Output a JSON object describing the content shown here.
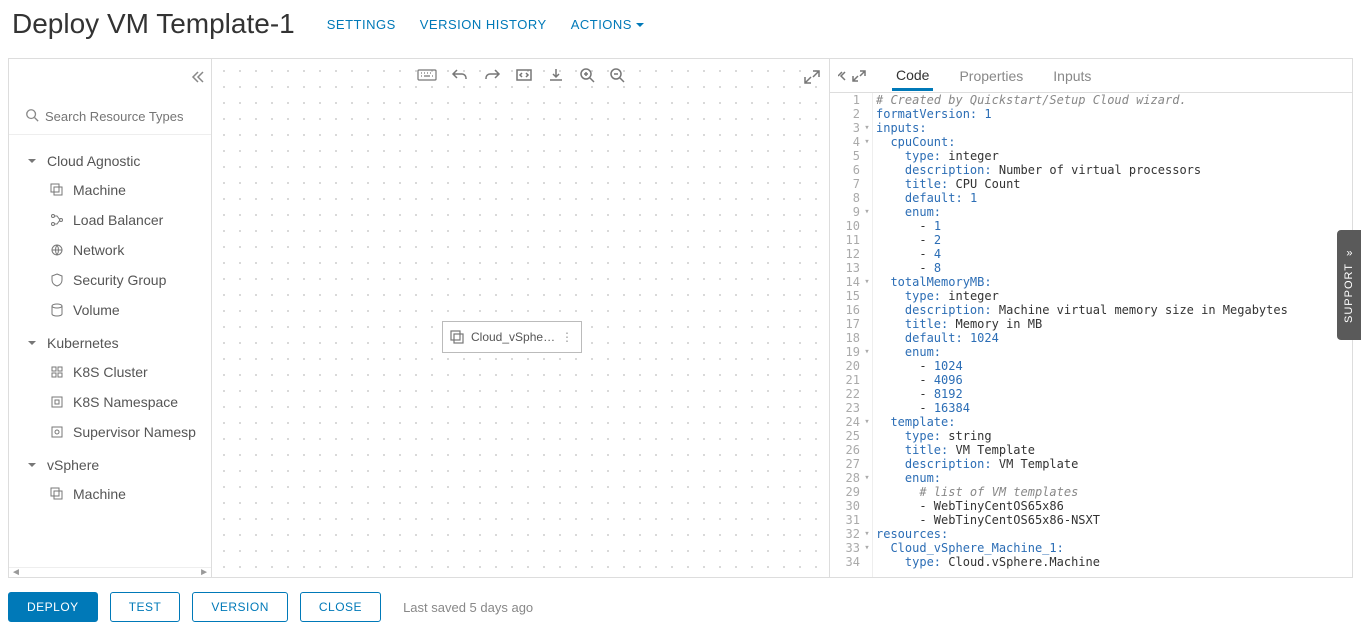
{
  "header": {
    "title": "Deploy VM Template-1",
    "links": {
      "settings": "SETTINGS",
      "version_history": "VERSION HISTORY",
      "actions": "ACTIONS"
    }
  },
  "sidebar": {
    "search_placeholder": "Search Resource Types",
    "groups": [
      {
        "label": "Cloud Agnostic",
        "items": [
          "Machine",
          "Load Balancer",
          "Network",
          "Security Group",
          "Volume"
        ]
      },
      {
        "label": "Kubernetes",
        "items": [
          "K8S Cluster",
          "K8S Namespace",
          "Supervisor Namesp"
        ]
      },
      {
        "label": "vSphere",
        "items": [
          "Machine"
        ]
      }
    ]
  },
  "canvas": {
    "node_label": "Cloud_vSpher…"
  },
  "codepanel": {
    "tabs": {
      "code": "Code",
      "properties": "Properties",
      "inputs": "Inputs"
    },
    "lines": [
      {
        "n": 1,
        "f": "",
        "html": "<span class='c'># Created by Quickstart/Setup Cloud wizard.</span>"
      },
      {
        "n": 2,
        "f": "",
        "html": "<span class='k'>formatVersion:</span> <span class='n'>1</span>"
      },
      {
        "n": 3,
        "f": "▾",
        "html": "<span class='k'>inputs:</span>"
      },
      {
        "n": 4,
        "f": "▾",
        "html": "  <span class='k'>cpuCount:</span>"
      },
      {
        "n": 5,
        "f": "",
        "html": "    <span class='k'>type:</span> <span class='v'>integer</span>"
      },
      {
        "n": 6,
        "f": "",
        "html": "    <span class='k'>description:</span> <span class='v'>Number of virtual processors</span>"
      },
      {
        "n": 7,
        "f": "",
        "html": "    <span class='k'>title:</span> <span class='v'>CPU Count</span>"
      },
      {
        "n": 8,
        "f": "",
        "html": "    <span class='k'>default:</span> <span class='n'>1</span>"
      },
      {
        "n": 9,
        "f": "▾",
        "html": "    <span class='k'>enum:</span>"
      },
      {
        "n": 10,
        "f": "",
        "html": "      <span class='v'>-</span> <span class='n'>1</span>"
      },
      {
        "n": 11,
        "f": "",
        "html": "      <span class='v'>-</span> <span class='n'>2</span>"
      },
      {
        "n": 12,
        "f": "",
        "html": "      <span class='v'>-</span> <span class='n'>4</span>"
      },
      {
        "n": 13,
        "f": "",
        "html": "      <span class='v'>-</span> <span class='n'>8</span>"
      },
      {
        "n": 14,
        "f": "▾",
        "html": "  <span class='k'>totalMemoryMB:</span>"
      },
      {
        "n": 15,
        "f": "",
        "html": "    <span class='k'>type:</span> <span class='v'>integer</span>"
      },
      {
        "n": 16,
        "f": "",
        "html": "    <span class='k'>description:</span> <span class='v'>Machine virtual memory size in Megabytes</span>"
      },
      {
        "n": 17,
        "f": "",
        "html": "    <span class='k'>title:</span> <span class='v'>Memory in MB</span>"
      },
      {
        "n": 18,
        "f": "",
        "html": "    <span class='k'>default:</span> <span class='n'>1024</span>"
      },
      {
        "n": 19,
        "f": "▾",
        "html": "    <span class='k'>enum:</span>"
      },
      {
        "n": 20,
        "f": "",
        "html": "      <span class='v'>-</span> <span class='n'>1024</span>"
      },
      {
        "n": 21,
        "f": "",
        "html": "      <span class='v'>-</span> <span class='n'>4096</span>"
      },
      {
        "n": 22,
        "f": "",
        "html": "      <span class='v'>-</span> <span class='n'>8192</span>"
      },
      {
        "n": 23,
        "f": "",
        "html": "      <span class='v'>-</span> <span class='n'>16384</span>"
      },
      {
        "n": 24,
        "f": "▾",
        "html": "  <span class='k'>template:</span>"
      },
      {
        "n": 25,
        "f": "",
        "html": "    <span class='k'>type:</span> <span class='v'>string</span>"
      },
      {
        "n": 26,
        "f": "",
        "html": "    <span class='k'>title:</span> <span class='v'>VM Template</span>"
      },
      {
        "n": 27,
        "f": "",
        "html": "    <span class='k'>description:</span> <span class='v'>VM Template</span>"
      },
      {
        "n": 28,
        "f": "▾",
        "html": "    <span class='k'>enum:</span>"
      },
      {
        "n": 29,
        "f": "",
        "html": "      <span class='c'># list of VM templates</span>"
      },
      {
        "n": 30,
        "f": "",
        "html": "      <span class='v'>- WebTinyCentOS65x86</span>"
      },
      {
        "n": 31,
        "f": "",
        "html": "      <span class='v'>- WebTinyCentOS65x86-NSXT</span>"
      },
      {
        "n": 32,
        "f": "▾",
        "html": "<span class='k'>resources:</span>"
      },
      {
        "n": 33,
        "f": "▾",
        "html": "  <span class='k'>Cloud_vSphere_Machine_1:</span>"
      },
      {
        "n": 34,
        "f": "",
        "html": "    <span class='k'>type:</span> <span class='v'>Cloud.vSphere.Machine</span>"
      }
    ]
  },
  "footer": {
    "deploy": "DEPLOY",
    "test": "TEST",
    "version": "VERSION",
    "close": "CLOSE",
    "saved": "Last saved 5 days ago"
  },
  "support": "SUPPORT"
}
